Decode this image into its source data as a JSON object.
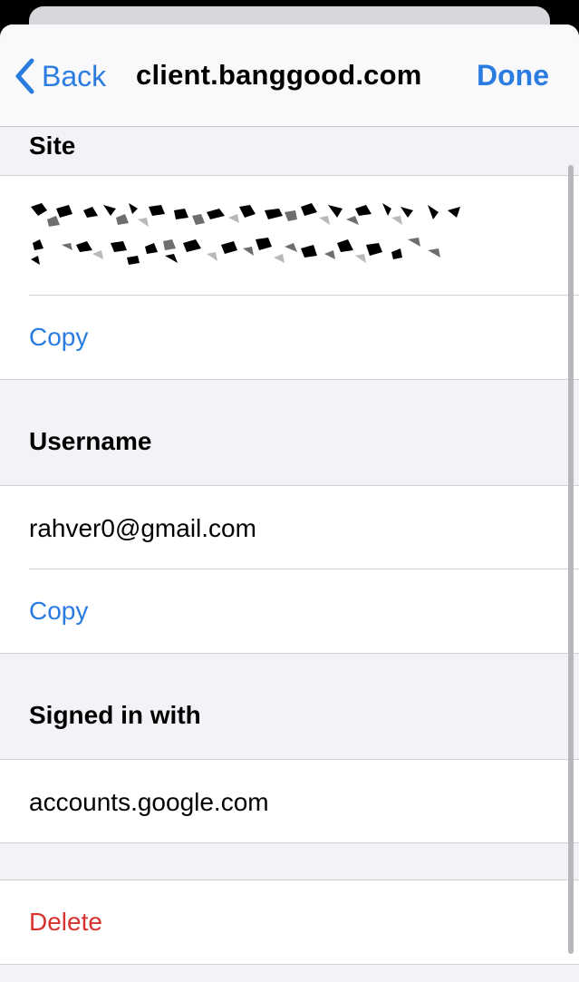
{
  "nav": {
    "back_label": "Back",
    "title": "client.banggood.com",
    "done_label": "Done"
  },
  "site": {
    "header": "Site",
    "copy_label": "Copy"
  },
  "username": {
    "header": "Username",
    "value": "rahver0@gmail.com",
    "copy_label": "Copy"
  },
  "signed_in": {
    "header": "Signed in with",
    "value": "accounts.google.com"
  },
  "actions": {
    "delete_label": "Delete"
  },
  "colors": {
    "accent": "#2a7ce0",
    "destructive": "#d8322f"
  }
}
